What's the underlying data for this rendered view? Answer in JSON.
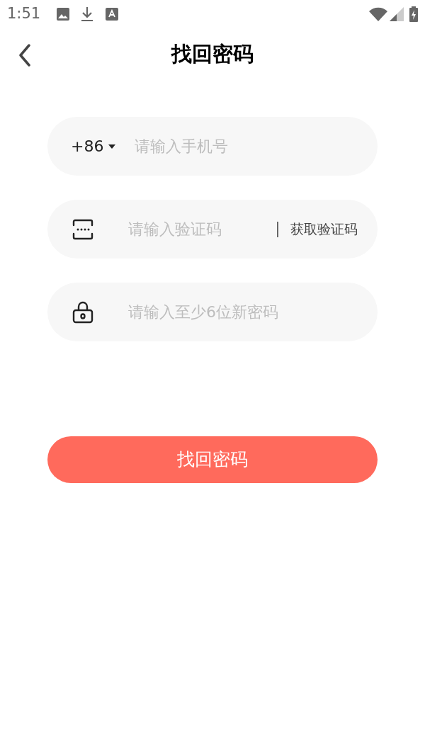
{
  "status_bar": {
    "time": "1:51"
  },
  "header": {
    "title": "找回密码"
  },
  "fields": [
    {
      "kind": "phone",
      "prefix": "+86",
      "placeholder": "请输入手机号"
    },
    {
      "kind": "code",
      "placeholder": "请输入验证码",
      "action": "获取验证码"
    },
    {
      "kind": "password",
      "placeholder": "请输入至少6位新密码"
    }
  ],
  "submit": {
    "label": "找回密码"
  }
}
